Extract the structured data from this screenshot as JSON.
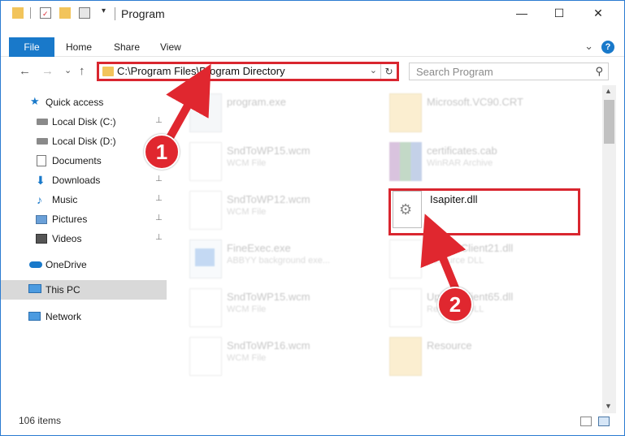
{
  "window": {
    "title": "Program",
    "minimize": "—",
    "maximize": "☐",
    "close": "✕"
  },
  "ribbon": {
    "tabs": [
      "File",
      "Home",
      "Share",
      "View"
    ],
    "help": "?",
    "chevron": "⌄"
  },
  "nav": {
    "back": "←",
    "forward": "→",
    "recent": "⌄",
    "up": "↑",
    "address": "C:\\Program Files\\Program Directory",
    "address_dropdown": "⌄",
    "refresh": "↻",
    "search_placeholder": "Search Program",
    "search_icon_glyph": "⚲"
  },
  "sidebar": {
    "items": [
      {
        "label": "Quick access",
        "icon": "star-icon",
        "pinned": false
      },
      {
        "label": "Local Disk (C:)",
        "icon": "drive-icon",
        "pinned": true
      },
      {
        "label": "Local Disk (D:)",
        "icon": "drive-icon",
        "pinned": false
      },
      {
        "label": "Documents",
        "icon": "documents-icon",
        "pinned": true
      },
      {
        "label": "Downloads",
        "icon": "downloads-icon",
        "pinned": true
      },
      {
        "label": "Music",
        "icon": "music-icon",
        "pinned": true
      },
      {
        "label": "Pictures",
        "icon": "pictures-icon",
        "pinned": true
      },
      {
        "label": "Videos",
        "icon": "videos-icon",
        "pinned": true
      },
      {
        "label": "OneDrive",
        "icon": "cloud-icon",
        "pinned": false
      },
      {
        "label": "This PC",
        "icon": "computer-icon",
        "pinned": false,
        "selected": true
      },
      {
        "label": "Network",
        "icon": "network-icon",
        "pinned": false
      }
    ],
    "pin_glyph": "📌"
  },
  "files": {
    "left": [
      {
        "name": "program.exe",
        "type": ""
      },
      {
        "name": "SndToWP15.wcm",
        "type": "WCM File"
      },
      {
        "name": "SndToWP12.wcm",
        "type": "WCM File"
      },
      {
        "name": "FineExec.exe",
        "type": "ABBYY background exe..."
      },
      {
        "name": "SndToWP15.wcm",
        "type": "WCM File"
      },
      {
        "name": "SndToWP16.wcm",
        "type": "WCM File"
      }
    ],
    "right": [
      {
        "name": "Microsoft.VC90.CRT",
        "type": ""
      },
      {
        "name": "certificates.cab",
        "type": "WinRAR Archive"
      },
      {
        "name": "Isapiter.dll",
        "type": "",
        "highlighted": true
      },
      {
        "name": "UpdateClient21.dll",
        "type": "Resource DLL"
      },
      {
        "name": "UpdateClient65.dll",
        "type": "Resource DLL"
      },
      {
        "name": "Resource",
        "type": ""
      }
    ]
  },
  "status": {
    "item_count": "106 items"
  },
  "annotations": {
    "step1": "1",
    "step2": "2",
    "color": "#e0272f"
  },
  "colors": {
    "accent": "#1979ca",
    "highlight": "#d9262f",
    "folder": "#f2c45b"
  }
}
